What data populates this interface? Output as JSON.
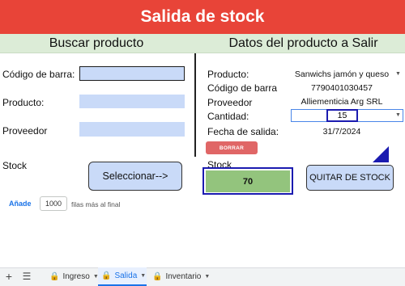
{
  "header": {
    "title": "Salida de stock"
  },
  "left": {
    "heading": "Buscar producto",
    "labels": {
      "codigo": "Código de barra:",
      "producto": "Producto:",
      "proveedor": "Proveedor",
      "stock": "Stock"
    },
    "select_button": "Seleccionar-->"
  },
  "right": {
    "heading": "Datos del producto a Salir",
    "labels": {
      "producto": "Producto:",
      "codigo": "Código de barra",
      "proveedor": "Proveedor",
      "cantidad": "Cantidad:",
      "fecha": "Fecha de salida:",
      "stock": "Stock"
    },
    "values": {
      "producto": "Sanwichs  jamón y queso",
      "codigo": "7790401030457",
      "proveedor": "Alliementicia  Arg  SRL",
      "cantidad": "15",
      "fecha": "31/7/2024"
    },
    "borrar_button": "BORRAR",
    "stock_value": "70",
    "quitar_button": "QUITAR DE STOCK"
  },
  "add_rows": {
    "link": "Añade",
    "count": "1000",
    "suffix": "filas más al final"
  },
  "tabs": [
    {
      "label": "Ingreso",
      "active": false
    },
    {
      "label": "Salida",
      "active": true
    },
    {
      "label": "Inventario",
      "active": false
    }
  ],
  "colors": {
    "title_bg": "#e84438",
    "header_bg": "#dcecd7",
    "input_bg": "#c9daf8",
    "stock_bg": "#93c47d",
    "borrar_bg": "#e06666",
    "accent_blue": "#1b1bb0"
  }
}
